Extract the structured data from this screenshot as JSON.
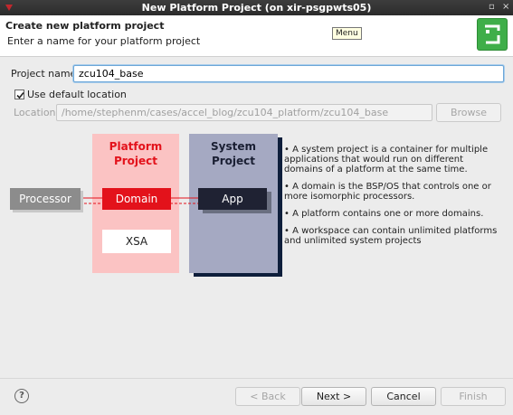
{
  "window": {
    "title": "New Platform Project  (on xir-psgpwts05)",
    "min_glyph": "▫",
    "close_glyph": "×"
  },
  "header": {
    "title": "Create new platform project",
    "subtitle": "Enter a name for your platform project",
    "menu_tooltip": "Menu",
    "logo_icon": "vitis-logo-icon"
  },
  "form": {
    "project_name_label": "Project name:",
    "project_name_value": "zcu104_base",
    "use_default_label": "Use default location",
    "use_default_checked": true,
    "location_label": "Location:",
    "location_value": "/home/stephenm/cases/accel_blog/zcu104_platform/zcu104_base",
    "browse_label": "Browse"
  },
  "diagram": {
    "platform_title_1": "Platform",
    "platform_title_2": "Project",
    "system_title_1": "System",
    "system_title_2": "Project",
    "processor": "Processor",
    "domain": "Domain",
    "app": "App",
    "xsa": "XSA",
    "colors": {
      "platform_bg": "#fbc3c3",
      "system_bg": "#a5a9c2",
      "domain_red": "#e3121b",
      "app_dark": "#1f2233"
    }
  },
  "bullets": [
    "• A system project is a container for multiple applications that would run on different domains of a platform at the same time.",
    "• A domain is the BSP/OS that controls one or more isomorphic processors.",
    "• A platform contains one or more domains.",
    "• A workspace can contain unlimited platforms and unlimited system projects"
  ],
  "footer": {
    "help_glyph": "?",
    "back_label": "< Back",
    "next_label": "Next >",
    "cancel_label": "Cancel",
    "finish_label": "Finish"
  }
}
